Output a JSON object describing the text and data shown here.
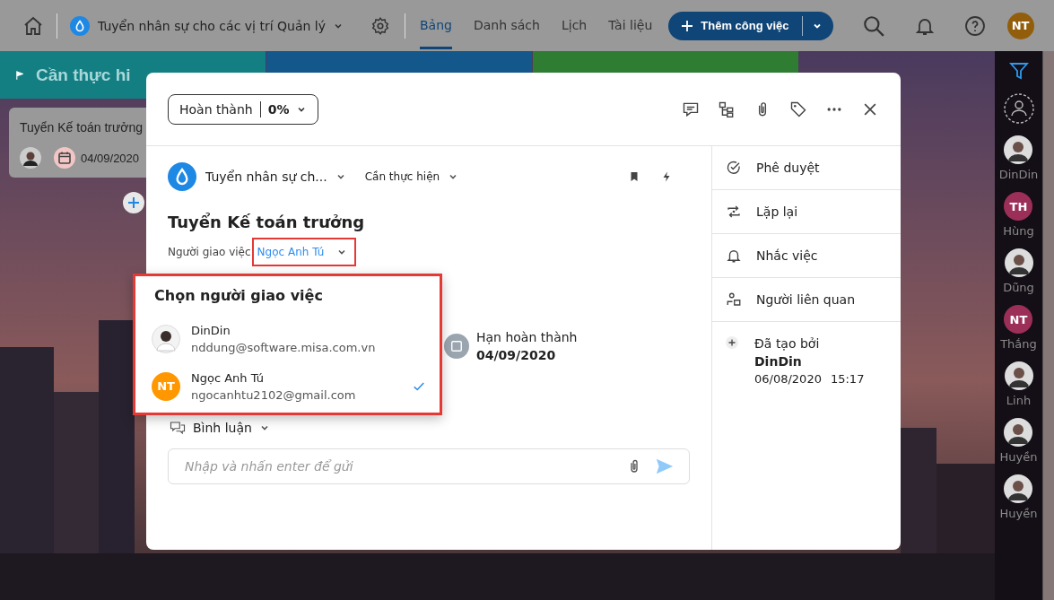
{
  "topbar": {
    "project": "Tuyển nhân sự cho các vị trí Quản lý",
    "tabs": [
      {
        "label": "Bảng",
        "selected": true
      },
      {
        "label": "Danh sách",
        "selected": false
      },
      {
        "label": "Lịch",
        "selected": false
      },
      {
        "label": "Tài liệu",
        "selected": false
      }
    ],
    "add_button": "Thêm công việc",
    "user_initials": "NT"
  },
  "board": {
    "columns": [
      {
        "title": "Cần thực hi",
        "color": "#137f82"
      },
      {
        "color": "#14578b"
      },
      {
        "color": "#2e7d32"
      }
    ],
    "card": {
      "title": "Tuyển Kế toán trưởng",
      "due": "04/09/2020"
    }
  },
  "members": [
    {
      "name": "DinDin"
    },
    {
      "name": "Hùng",
      "kind": "initials",
      "initials": "TH",
      "color": "#9c2f58"
    },
    {
      "name": "Dũng"
    },
    {
      "name": "Thắng",
      "kind": "initials",
      "initials": "NT",
      "color": "#9c2f58"
    },
    {
      "name": "Linh"
    },
    {
      "name": "Huyền"
    },
    {
      "name": "Huyền"
    }
  ],
  "task": {
    "status": "Hoàn thành",
    "progress": "0%",
    "project": "Tuyển nhân sự ch...",
    "stage": "Cần thực hiện",
    "title": "Tuyển Kế toán trưởng",
    "assigner_label": "Người giao việc",
    "assigner": "Ngọc Anh Tú",
    "deadline_label": "Hạn hoàn thành",
    "deadline": "04/09/2020",
    "comments_label": "Bình luận",
    "comment_placeholder": "Nhập và nhấn enter để gửi"
  },
  "assigner_picker": {
    "title": "Chọn người giao việc",
    "people": [
      {
        "name": "DinDin",
        "email": "nddung@software.misa.com.vn",
        "selected": false
      },
      {
        "name": "Ngọc Anh Tú",
        "email": "ngocanhtu2102@gmail.com",
        "kind": "initials",
        "initials": "NT",
        "selected": true
      }
    ]
  },
  "side_actions": [
    {
      "label": "Phê duyệt",
      "kind": "approve"
    },
    {
      "label": "Lặp lại",
      "kind": "repeat"
    },
    {
      "label": "Nhắc việc",
      "kind": "remind"
    },
    {
      "label": "Người liên quan",
      "kind": "related"
    }
  ],
  "created": {
    "label": "Đã tạo bởi",
    "by": "DinDin",
    "date": "06/08/2020",
    "time": "15:17"
  }
}
